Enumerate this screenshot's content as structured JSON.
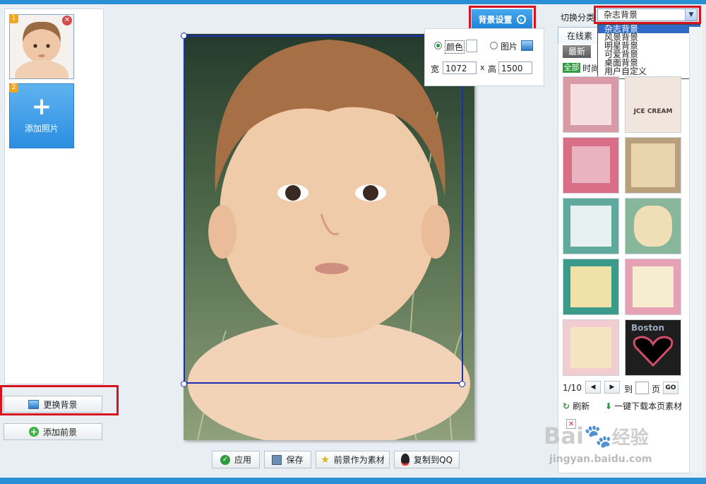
{
  "left": {
    "photo_badge": "1",
    "add_badge": "2",
    "add_photo_label": "添加照片",
    "change_bg_label": "更换背景",
    "add_fg_label": "添加前景"
  },
  "bg_settings": {
    "button_label": "背景设置",
    "color_label": "颜色",
    "image_label": "图片",
    "width_label": "宽",
    "width_value": "1072",
    "times": "x",
    "height_label": "高",
    "height_value": "1500"
  },
  "right": {
    "category_label": "切换分类",
    "selected": "杂志背景",
    "options": [
      "杂志背景",
      "风景背景",
      "明星背景",
      "可爱背景",
      "桌面背景",
      "用户自定义"
    ],
    "tab_online": "在线素",
    "btn_latest": "最新",
    "tag_all": "全部",
    "tag_fashion": "时尚",
    "page_info": "1/10",
    "goto_label": "到",
    "page_label": "页",
    "go_label": "GO",
    "refresh_label": "刷新",
    "download_label": "一键下载本页素材",
    "tile_text": [
      "",
      "JCE CREAM",
      "",
      "",
      "",
      "",
      "",
      "",
      "",
      "Boston"
    ]
  },
  "bottom": {
    "apply": "应用",
    "save": "保存",
    "fg_as_material": "前景作为素材",
    "copy_qq": "复制到QQ"
  },
  "watermark": {
    "logo": "Bai",
    "logo_cn": "经验",
    "url": "jingyan.baidu.com"
  }
}
